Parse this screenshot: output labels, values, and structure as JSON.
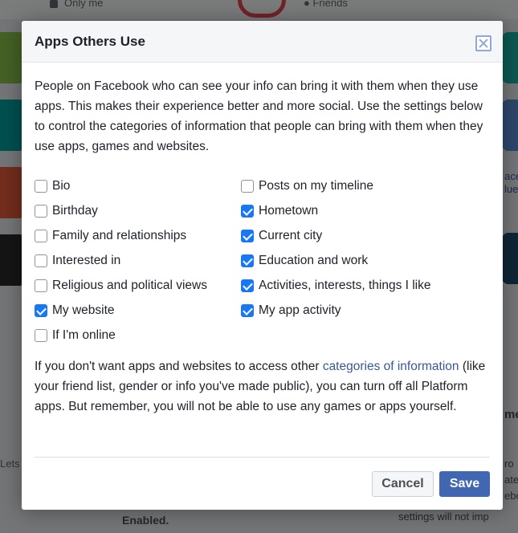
{
  "background": {
    "privacy_label": "Only me",
    "friends_label": "Friends",
    "enabled_label": "Enabled.",
    "settings_note": "settings will not imp",
    "left_fragment": "Lets",
    "right_fragments": [
      "me",
      "ro",
      "ate",
      "ebo"
    ],
    "right_tile_text": [
      "ace",
      "lue"
    ]
  },
  "dialog": {
    "title": "Apps Others Use",
    "intro": "People on Facebook who can see your info can bring it with them when they use apps. This makes their experience better and more social. Use the settings below to control the categories of information that people can bring with them when they use apps, games and websites.",
    "options_left": [
      {
        "label": "Bio",
        "checked": false
      },
      {
        "label": "Birthday",
        "checked": false
      },
      {
        "label": "Family and relationships",
        "checked": false
      },
      {
        "label": "Interested in",
        "checked": false
      },
      {
        "label": "Religious and political views",
        "checked": false
      },
      {
        "label": "My website",
        "checked": true
      },
      {
        "label": "If I'm online",
        "checked": false
      }
    ],
    "options_right": [
      {
        "label": "Posts on my timeline",
        "checked": false
      },
      {
        "label": "Hometown",
        "checked": true
      },
      {
        "label": "Current city",
        "checked": true
      },
      {
        "label": "Education and work",
        "checked": true
      },
      {
        "label": "Activities, interests, things I like",
        "checked": true
      },
      {
        "label": "My app activity",
        "checked": true
      }
    ],
    "note_before_link": "If you don't want apps and websites to access other ",
    "note_link": "categories of information",
    "note_after_link": " (like your friend list, gender or info you've made public), you can turn off all Platform apps. But remember, you will not be able to use any games or apps yourself.",
    "cancel_label": "Cancel",
    "save_label": "Save"
  },
  "colors": {
    "accent": "#1877f2",
    "save_button": "#4267b2",
    "link": "#385898"
  }
}
